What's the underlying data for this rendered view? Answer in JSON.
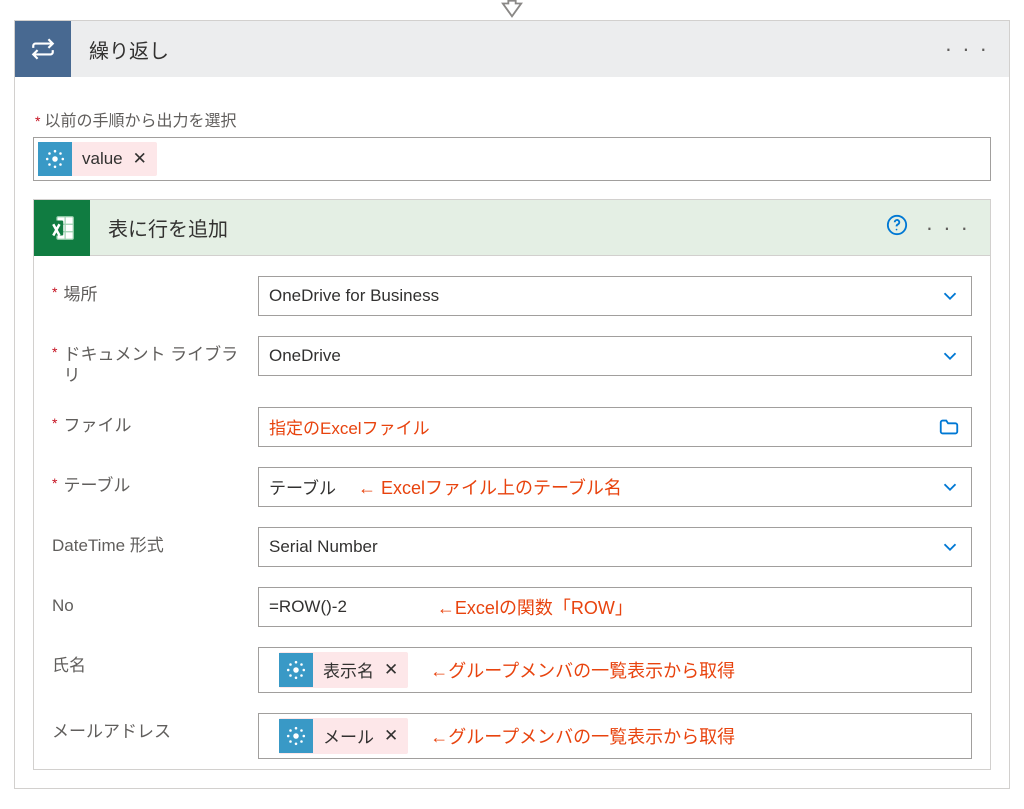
{
  "loop_card": {
    "title": "繰り返し",
    "prev_output_label": "以前の手順から出力を選択",
    "tokens": [
      {
        "label": "value"
      }
    ]
  },
  "excel_card": {
    "title": "表に行を追加",
    "fields": {
      "location": {
        "label": "場所",
        "value": "OneDrive for Business",
        "required": true
      },
      "library": {
        "label": "ドキュメント ライブラリ",
        "value": "OneDrive",
        "required": true
      },
      "file": {
        "label": "ファイル",
        "value": "指定のExcelファイル",
        "required": true
      },
      "table": {
        "label": "テーブル",
        "value": "テーブル",
        "required": true,
        "annotation": "← Excelファイル上のテーブル名"
      },
      "datetime": {
        "label": "DateTime 形式",
        "value": "Serial Number",
        "required": false
      },
      "no": {
        "label": "No",
        "value": "=ROW()-2",
        "required": false,
        "annotation": "←Excelの関数「ROW」"
      },
      "name": {
        "label": "氏名",
        "token": "表示名",
        "required": false,
        "annotation": "←グループメンバの一覧表示から取得"
      },
      "email": {
        "label": "メールアドレス",
        "token": "メール",
        "required": false,
        "annotation": "←グループメンバの一覧表示から取得"
      }
    }
  }
}
